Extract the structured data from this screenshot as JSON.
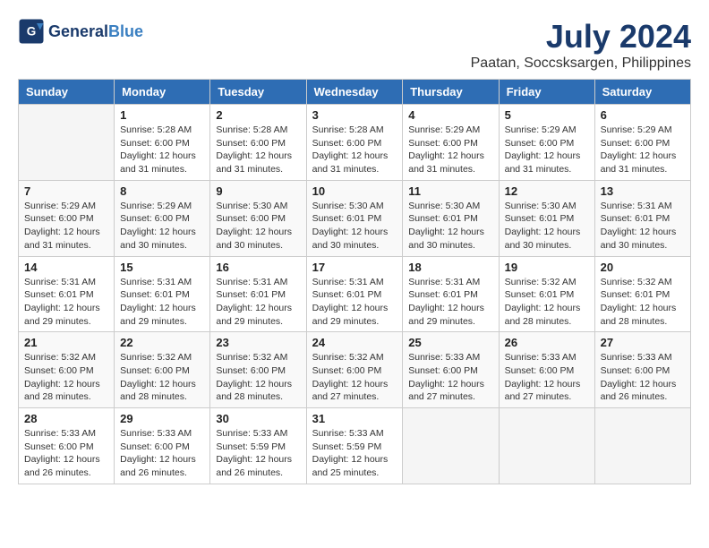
{
  "header": {
    "logo_text_general": "General",
    "logo_text_blue": "Blue",
    "title": "July 2024",
    "subtitle": "Paatan, Soccsksargen, Philippines"
  },
  "calendar": {
    "days_of_week": [
      "Sunday",
      "Monday",
      "Tuesday",
      "Wednesday",
      "Thursday",
      "Friday",
      "Saturday"
    ],
    "weeks": [
      [
        {
          "day": "",
          "info": ""
        },
        {
          "day": "1",
          "info": "Sunrise: 5:28 AM\nSunset: 6:00 PM\nDaylight: 12 hours\nand 31 minutes."
        },
        {
          "day": "2",
          "info": "Sunrise: 5:28 AM\nSunset: 6:00 PM\nDaylight: 12 hours\nand 31 minutes."
        },
        {
          "day": "3",
          "info": "Sunrise: 5:28 AM\nSunset: 6:00 PM\nDaylight: 12 hours\nand 31 minutes."
        },
        {
          "day": "4",
          "info": "Sunrise: 5:29 AM\nSunset: 6:00 PM\nDaylight: 12 hours\nand 31 minutes."
        },
        {
          "day": "5",
          "info": "Sunrise: 5:29 AM\nSunset: 6:00 PM\nDaylight: 12 hours\nand 31 minutes."
        },
        {
          "day": "6",
          "info": "Sunrise: 5:29 AM\nSunset: 6:00 PM\nDaylight: 12 hours\nand 31 minutes."
        }
      ],
      [
        {
          "day": "7",
          "info": "Sunrise: 5:29 AM\nSunset: 6:00 PM\nDaylight: 12 hours\nand 31 minutes."
        },
        {
          "day": "8",
          "info": "Sunrise: 5:29 AM\nSunset: 6:00 PM\nDaylight: 12 hours\nand 30 minutes."
        },
        {
          "day": "9",
          "info": "Sunrise: 5:30 AM\nSunset: 6:00 PM\nDaylight: 12 hours\nand 30 minutes."
        },
        {
          "day": "10",
          "info": "Sunrise: 5:30 AM\nSunset: 6:01 PM\nDaylight: 12 hours\nand 30 minutes."
        },
        {
          "day": "11",
          "info": "Sunrise: 5:30 AM\nSunset: 6:01 PM\nDaylight: 12 hours\nand 30 minutes."
        },
        {
          "day": "12",
          "info": "Sunrise: 5:30 AM\nSunset: 6:01 PM\nDaylight: 12 hours\nand 30 minutes."
        },
        {
          "day": "13",
          "info": "Sunrise: 5:31 AM\nSunset: 6:01 PM\nDaylight: 12 hours\nand 30 minutes."
        }
      ],
      [
        {
          "day": "14",
          "info": "Sunrise: 5:31 AM\nSunset: 6:01 PM\nDaylight: 12 hours\nand 29 minutes."
        },
        {
          "day": "15",
          "info": "Sunrise: 5:31 AM\nSunset: 6:01 PM\nDaylight: 12 hours\nand 29 minutes."
        },
        {
          "day": "16",
          "info": "Sunrise: 5:31 AM\nSunset: 6:01 PM\nDaylight: 12 hours\nand 29 minutes."
        },
        {
          "day": "17",
          "info": "Sunrise: 5:31 AM\nSunset: 6:01 PM\nDaylight: 12 hours\nand 29 minutes."
        },
        {
          "day": "18",
          "info": "Sunrise: 5:31 AM\nSunset: 6:01 PM\nDaylight: 12 hours\nand 29 minutes."
        },
        {
          "day": "19",
          "info": "Sunrise: 5:32 AM\nSunset: 6:01 PM\nDaylight: 12 hours\nand 28 minutes."
        },
        {
          "day": "20",
          "info": "Sunrise: 5:32 AM\nSunset: 6:01 PM\nDaylight: 12 hours\nand 28 minutes."
        }
      ],
      [
        {
          "day": "21",
          "info": "Sunrise: 5:32 AM\nSunset: 6:00 PM\nDaylight: 12 hours\nand 28 minutes."
        },
        {
          "day": "22",
          "info": "Sunrise: 5:32 AM\nSunset: 6:00 PM\nDaylight: 12 hours\nand 28 minutes."
        },
        {
          "day": "23",
          "info": "Sunrise: 5:32 AM\nSunset: 6:00 PM\nDaylight: 12 hours\nand 28 minutes."
        },
        {
          "day": "24",
          "info": "Sunrise: 5:32 AM\nSunset: 6:00 PM\nDaylight: 12 hours\nand 27 minutes."
        },
        {
          "day": "25",
          "info": "Sunrise: 5:33 AM\nSunset: 6:00 PM\nDaylight: 12 hours\nand 27 minutes."
        },
        {
          "day": "26",
          "info": "Sunrise: 5:33 AM\nSunset: 6:00 PM\nDaylight: 12 hours\nand 27 minutes."
        },
        {
          "day": "27",
          "info": "Sunrise: 5:33 AM\nSunset: 6:00 PM\nDaylight: 12 hours\nand 26 minutes."
        }
      ],
      [
        {
          "day": "28",
          "info": "Sunrise: 5:33 AM\nSunset: 6:00 PM\nDaylight: 12 hours\nand 26 minutes."
        },
        {
          "day": "29",
          "info": "Sunrise: 5:33 AM\nSunset: 6:00 PM\nDaylight: 12 hours\nand 26 minutes."
        },
        {
          "day": "30",
          "info": "Sunrise: 5:33 AM\nSunset: 5:59 PM\nDaylight: 12 hours\nand 26 minutes."
        },
        {
          "day": "31",
          "info": "Sunrise: 5:33 AM\nSunset: 5:59 PM\nDaylight: 12 hours\nand 25 minutes."
        },
        {
          "day": "",
          "info": ""
        },
        {
          "day": "",
          "info": ""
        },
        {
          "day": "",
          "info": ""
        }
      ]
    ]
  }
}
